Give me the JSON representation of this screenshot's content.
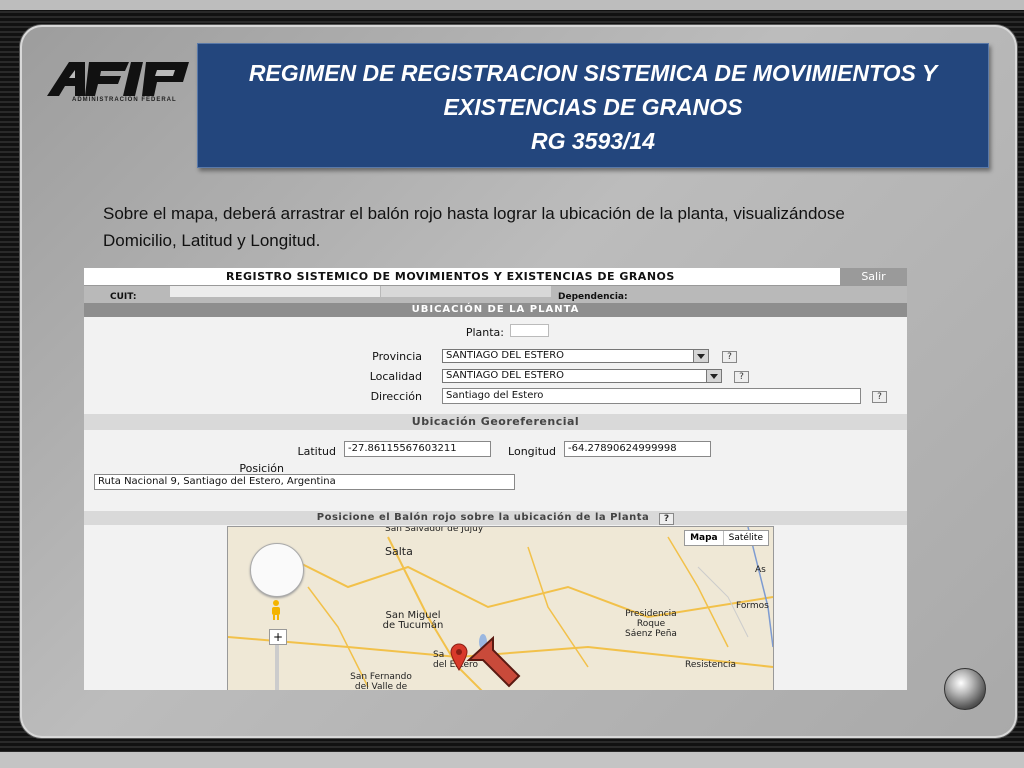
{
  "header": {
    "logo_text": "AFIP",
    "logo_subtitle": "ADMINISTRACION FEDERAL",
    "title_line1": "REGIMEN DE REGISTRACION SISTEMICA DE MOVIMIENTOS Y",
    "title_line2": "EXISTENCIAS DE GRANOS",
    "title_line3": "RG  3593/14"
  },
  "intro": {
    "line1": "Sobre el mapa, deberá arrastrar el balón rojo hasta lograr la ubicación de la planta, visualizándose",
    "line2": "Domicilio, Latitud y Longitud."
  },
  "app": {
    "title": "REGISTRO SISTEMICO DE MOVIMIENTOS Y EXISTENCIAS DE GRANOS",
    "salir": "Salir",
    "cuit_label": "CUIT:",
    "dependencia_label": "Dependencia:",
    "section_title": "UBICACIÓN DE LA PLANTA",
    "planta_label": "Planta:",
    "provincia_label": "Provincia",
    "provincia_value": "SANTIAGO DEL ESTERO",
    "localidad_label": "Localidad",
    "localidad_value": "SANTIAGO DEL ESTERO",
    "direccion_label": "Dirección",
    "direccion_value": "Santiago del Estero",
    "help": "?",
    "geo_title": "Ubicación Georeferencial",
    "latitud_label": "Latitud",
    "latitud_value": "-27.86115567603211",
    "longitud_label": "Longitud",
    "longitud_value": "-64.27890624999998",
    "posicion_label": "Posición",
    "posicion_value": "Ruta Nacional 9, Santiago del Estero, Argentina",
    "map_instruction": "Posicione el Balón rojo sobre la ubicación de la Planta",
    "map_type_map": "Mapa",
    "map_type_sat": "Satélite",
    "zoom_plus": "+",
    "cities": {
      "jujuy": "San Salvador\nde Jujuy",
      "salta": "Salta",
      "as": "As",
      "formosa": "Formos",
      "tucuman": "San Miguel\nde Tucumán",
      "presidencia": "Presidencia\nRoque\nSáenz Peña",
      "santiago": "Sa\ndel Estero",
      "resistencia": "Resistencia",
      "catamarca": "San Fernando\ndel Valle de"
    }
  },
  "colors": {
    "banner": "#23467d",
    "marker": "#d93a2b",
    "arrow": "#c94a3a"
  }
}
